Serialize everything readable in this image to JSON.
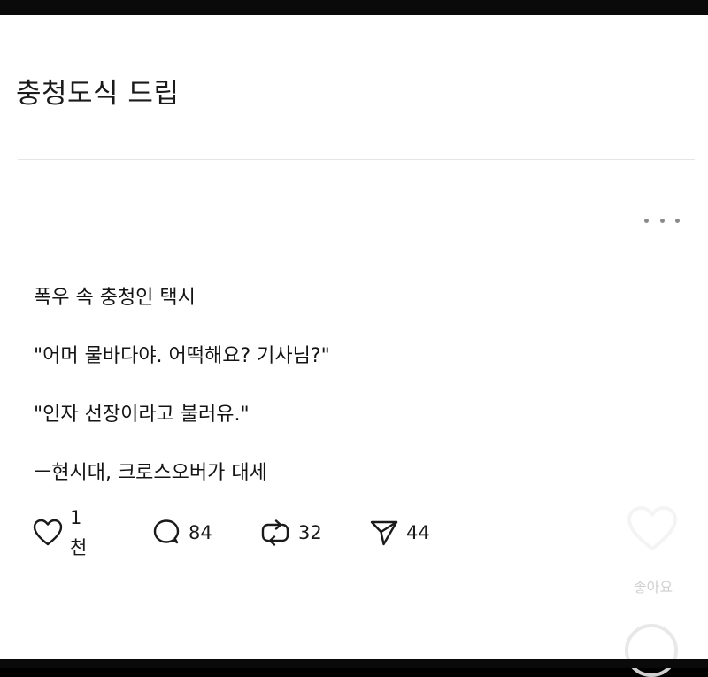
{
  "header": {
    "title": "충청도식 드립"
  },
  "post": {
    "lines": [
      "폭우 속 충청인 택시",
      "\"어머 물바다야. 어떡해요? 기사님?\"",
      "\"인자 선장이라고 불러유.\"",
      "ㅡ현시대, 크로스오버가 대세"
    ],
    "menu_icon": "more-horizontal-icon"
  },
  "actions": {
    "like": {
      "icon": "heart-icon",
      "count": "1천"
    },
    "comment": {
      "icon": "comment-icon",
      "count": "84"
    },
    "repost": {
      "icon": "repost-icon",
      "count": "32"
    },
    "share": {
      "icon": "send-icon",
      "count": "44"
    }
  },
  "overlay": {
    "like_label": "좋아요"
  }
}
